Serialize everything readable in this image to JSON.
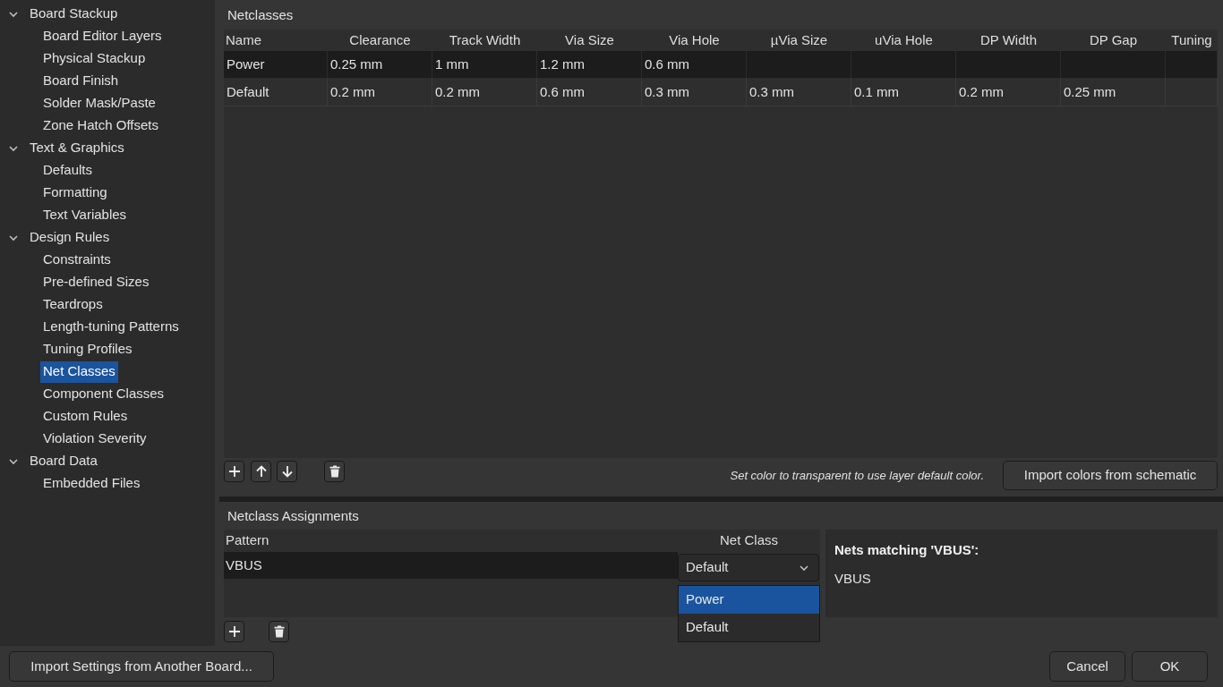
{
  "sidebar": {
    "items": [
      {
        "label": "Board Stackup",
        "expanded": true,
        "selected": false,
        "children": [
          {
            "label": "Board Editor Layers",
            "selected": false
          },
          {
            "label": "Physical Stackup",
            "selected": false
          },
          {
            "label": "Board Finish",
            "selected": false
          },
          {
            "label": "Solder Mask/Paste",
            "selected": false
          },
          {
            "label": "Zone Hatch Offsets",
            "selected": false
          }
        ]
      },
      {
        "label": "Text & Graphics",
        "expanded": true,
        "selected": false,
        "children": [
          {
            "label": "Defaults",
            "selected": false
          },
          {
            "label": "Formatting",
            "selected": false
          },
          {
            "label": "Text Variables",
            "selected": false
          }
        ]
      },
      {
        "label": "Design Rules",
        "expanded": true,
        "selected": false,
        "children": [
          {
            "label": "Constraints",
            "selected": false
          },
          {
            "label": "Pre-defined Sizes",
            "selected": false
          },
          {
            "label": "Teardrops",
            "selected": false
          },
          {
            "label": "Length-tuning Patterns",
            "selected": false
          },
          {
            "label": "Tuning Profiles",
            "selected": false
          },
          {
            "label": "Net Classes",
            "selected": true
          },
          {
            "label": "Component Classes",
            "selected": false
          },
          {
            "label": "Custom Rules",
            "selected": false
          },
          {
            "label": "Violation Severity",
            "selected": false
          }
        ]
      },
      {
        "label": "Board Data",
        "expanded": true,
        "selected": false,
        "children": [
          {
            "label": "Embedded Files",
            "selected": false
          }
        ]
      }
    ]
  },
  "netclasses": {
    "title": "Netclasses",
    "columns": [
      "Name",
      "Clearance",
      "Track Width",
      "Via Size",
      "Via Hole",
      "µVia Size",
      "uVia Hole",
      "DP Width",
      "DP Gap",
      "Tuning"
    ],
    "rows": [
      {
        "kind": "custom",
        "cells": [
          "Power",
          "0.25 mm",
          "1 mm",
          "1.2 mm",
          "0.6 mm"
        ]
      },
      {
        "kind": "default",
        "cells": [
          "Default",
          "0.2 mm",
          "0.2 mm",
          "0.6 mm",
          "0.3 mm",
          "0.3 mm",
          "0.1 mm",
          "0.2 mm",
          "0.25 mm"
        ]
      }
    ],
    "hint": "Set color to transparent to use layer default color.",
    "import_button": "Import colors from schematic"
  },
  "assignments": {
    "title": "Netclass Assignments",
    "columns": [
      "Pattern",
      "Net Class"
    ],
    "rows": [
      {
        "pattern": "VBUS",
        "net_class": "Default"
      }
    ],
    "dropdown": {
      "expanded": true,
      "options": [
        {
          "label": "Power",
          "selected": true
        },
        {
          "label": "Default",
          "selected": false
        }
      ]
    }
  },
  "matches": {
    "title": "Nets matching 'VBUS':",
    "nets": [
      "VBUS"
    ]
  },
  "footer": {
    "import_button": "Import Settings from Another Board...",
    "buttons": [
      "Cancel",
      "OK"
    ]
  }
}
